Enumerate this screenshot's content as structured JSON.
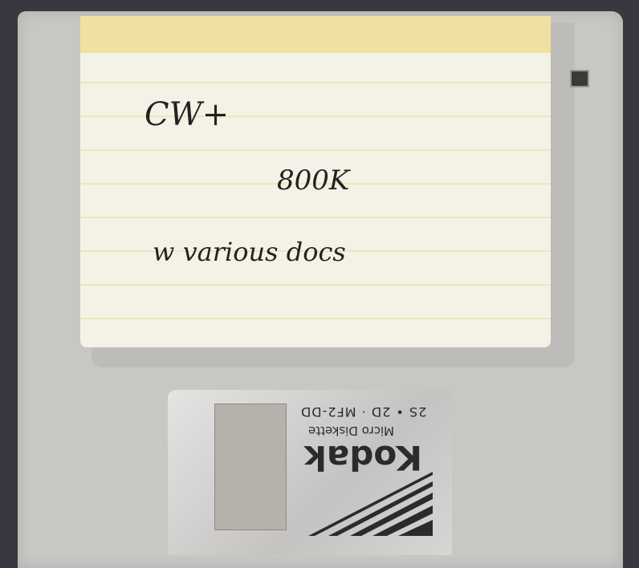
{
  "label": {
    "line1": "CW+",
    "line2": "800K",
    "line3": "w various docs"
  },
  "shutter": {
    "brand": "Kodak",
    "product": "Micro Diskette",
    "spec": "2S • 2D · MF2-DD"
  },
  "colors": {
    "background": "#3b3740",
    "disk_body": "#c8c7c4",
    "label_strip": "#efe2a0",
    "label": "#f4f1e6"
  }
}
